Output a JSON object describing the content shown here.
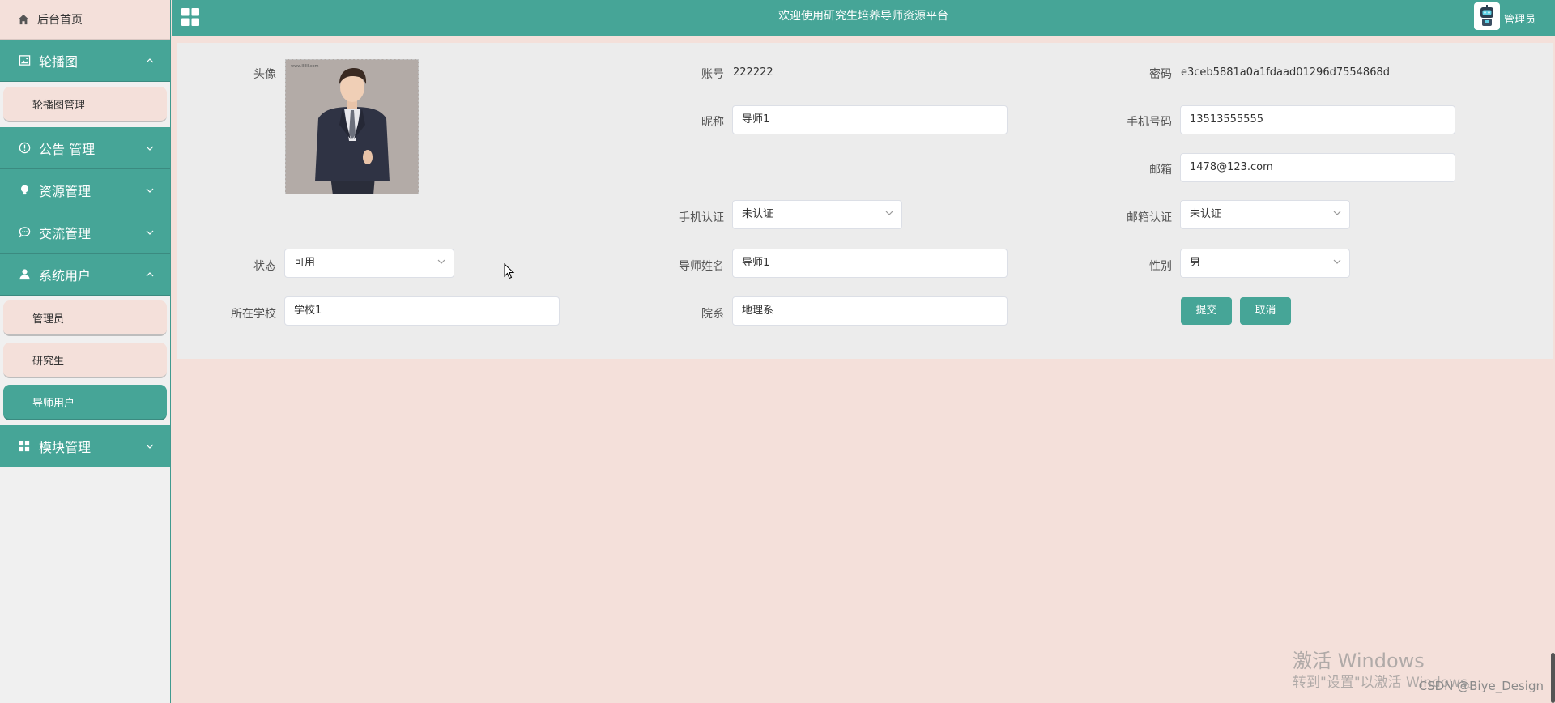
{
  "app": {
    "title": "欢迎使用研究生培养导师资源平台",
    "user": "管理员"
  },
  "sidebar": {
    "home": "后台首页",
    "groups": [
      {
        "label": "轮播图",
        "items": [
          "轮播图管理"
        ]
      },
      {
        "label": "公告 管理",
        "items": []
      },
      {
        "label": "资源管理",
        "items": []
      },
      {
        "label": "交流管理",
        "items": []
      },
      {
        "label": "系统用户",
        "items": [
          "管理员",
          "研究生",
          "导师用户"
        ]
      },
      {
        "label": "模块管理",
        "items": []
      }
    ],
    "active_item": "导师用户"
  },
  "form": {
    "avatar_label": "头像",
    "account": {
      "label": "账号",
      "value": "222222"
    },
    "password": {
      "label": "密码",
      "value": "e3ceb5881a0a1fdaad01296d7554868d"
    },
    "nickname": {
      "label": "昵称",
      "value": "导师1"
    },
    "phone": {
      "label": "手机号码",
      "value": "13513555555"
    },
    "email": {
      "label": "邮箱",
      "value": "1478@123.com"
    },
    "phone_verify": {
      "label": "手机认证",
      "value": "未认证"
    },
    "email_verify": {
      "label": "邮箱认证",
      "value": "未认证"
    },
    "status": {
      "label": "状态",
      "value": "可用"
    },
    "tutor_name": {
      "label": "导师姓名",
      "value": "导师1"
    },
    "gender": {
      "label": "性别",
      "value": "男"
    },
    "school": {
      "label": "所在学校",
      "value": "学校1"
    },
    "department": {
      "label": "院系",
      "value": "地理系"
    },
    "submit_label": "提交",
    "cancel_label": "取消"
  },
  "overlay": {
    "windows_line1": "激活 Windows",
    "windows_line2": "转到\"设置\"以激活 Windows。",
    "csdn": "CSDN @Biye_Design"
  },
  "colors": {
    "primary": "#46a597",
    "page_bg": "#f4e0da",
    "panel_bg": "#ececec"
  }
}
